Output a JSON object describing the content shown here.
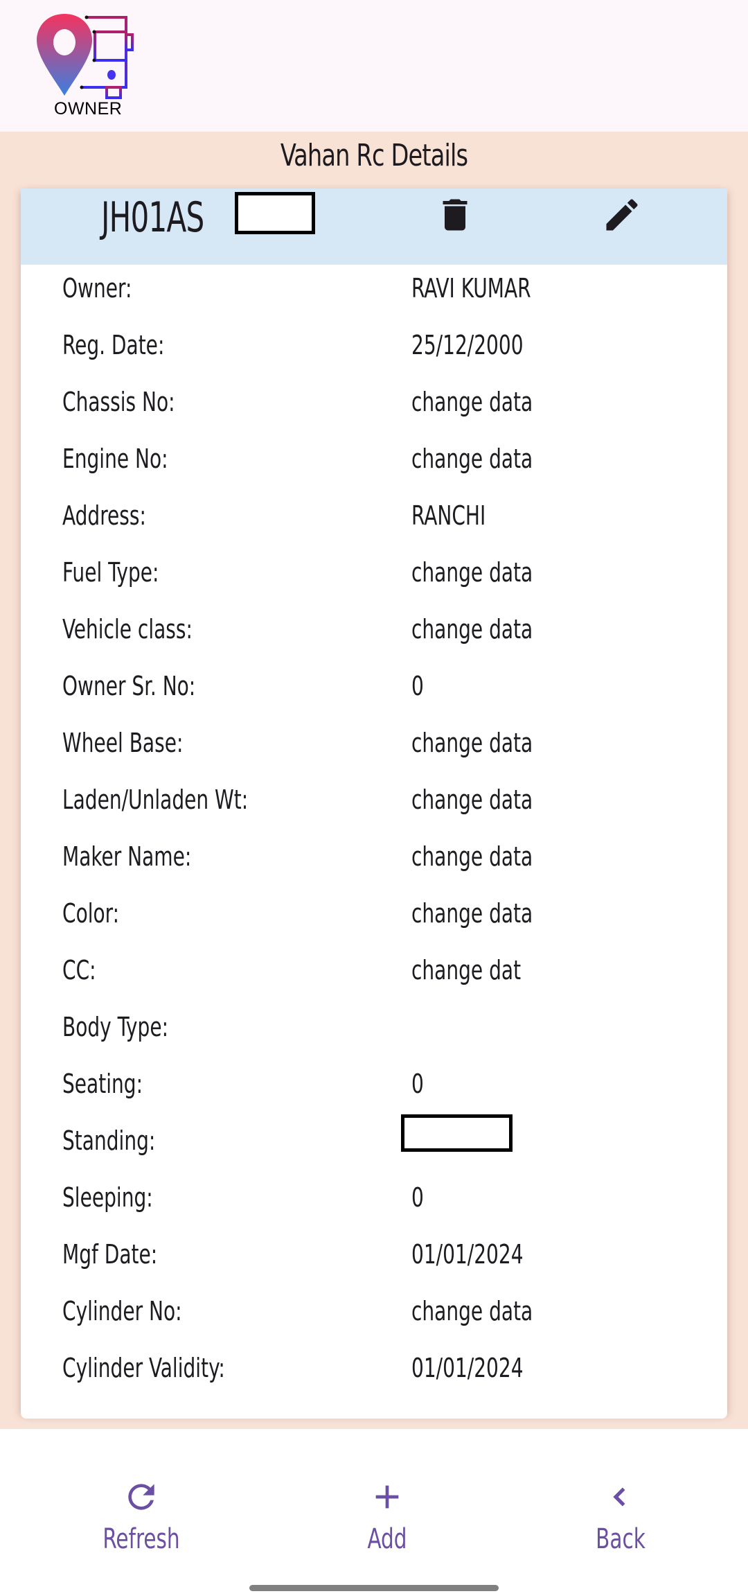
{
  "app": {
    "logo_text": "OWNER",
    "title": "Vahan Rc Details"
  },
  "vehicle": {
    "plate_prefix": "JH01AS",
    "plate_suffix_redacted": ""
  },
  "actions": {
    "delete_icon": "trash-icon",
    "edit_icon": "pencil-icon"
  },
  "details": [
    {
      "label": "Owner:",
      "value": "RAVI KUMAR"
    },
    {
      "label": "Reg. Date:",
      "value": "25/12/2000"
    },
    {
      "label": "Chassis No:",
      "value": "change data"
    },
    {
      "label": "Engine No:",
      "value": "change data"
    },
    {
      "label": "Address:",
      "value": "RANCHI"
    },
    {
      "label": "Fuel Type:",
      "value": "change data"
    },
    {
      "label": "Vehicle class:",
      "value": "change data"
    },
    {
      "label": "Owner Sr. No:",
      "value": "0"
    },
    {
      "label": "Wheel Base:",
      "value": "change data"
    },
    {
      "label": "Laden/Unladen Wt:",
      "value": "change data"
    },
    {
      "label": "Maker Name:",
      "value": "change data"
    },
    {
      "label": "Color:",
      "value": "change data"
    },
    {
      "label": "CC:",
      "value": "change dat"
    },
    {
      "label": "Body Type:",
      "value": ""
    },
    {
      "label": "Seating:",
      "value": "0"
    },
    {
      "label": "Standing:",
      "value": "",
      "redacted": true
    },
    {
      "label": "Sleeping:",
      "value": "0"
    },
    {
      "label": "Mgf Date:",
      "value": "01/01/2024"
    },
    {
      "label": "Cylinder No:",
      "value": "change data"
    },
    {
      "label": "Cylinder Validity:",
      "value": "01/01/2024"
    }
  ],
  "bottom_nav": [
    {
      "label": "Refresh",
      "icon": "refresh-icon"
    },
    {
      "label": "Add",
      "icon": "plus-icon"
    },
    {
      "label": "Back",
      "icon": "chevron-left-icon"
    }
  ],
  "colors": {
    "accent": "#6a4fa3",
    "page_bg": "#f8e1d5",
    "card_header_bg": "#d6e8f6",
    "top_bar_bg": "#fdf7fb"
  }
}
